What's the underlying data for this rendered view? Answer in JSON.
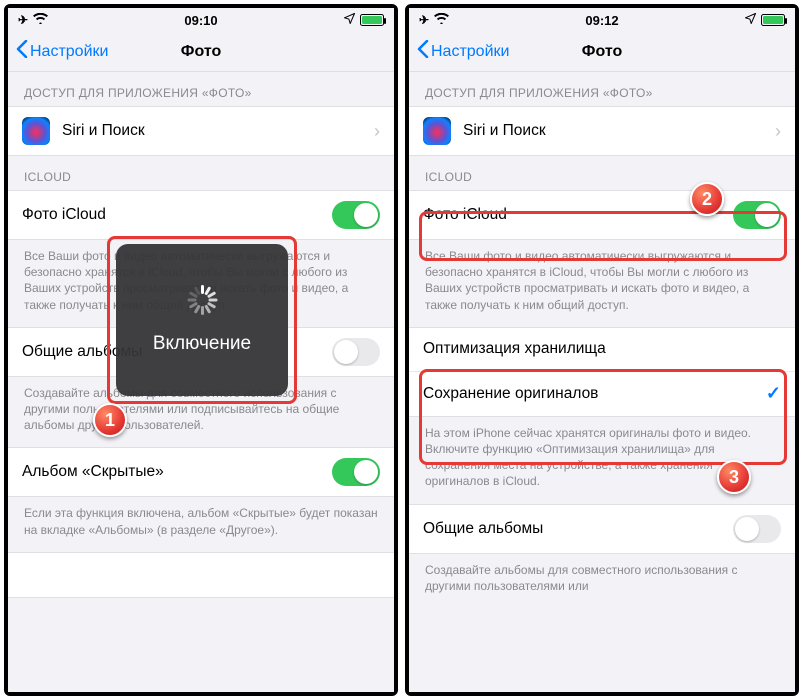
{
  "left": {
    "status_time": "09:10",
    "nav_back": "Настройки",
    "nav_title": "Фото",
    "section_app_access": "ДОСТУП ДЛЯ ПРИЛОЖЕНИЯ «ФОТО»",
    "siri_search": "Siri и Поиск",
    "section_icloud": "ICLOUD",
    "icloud_photo": "Фото iCloud",
    "icloud_footer": "Все Ваши фото и видео автоматически выгружаются и безопасно хранятся в iCloud, чтобы Вы могли с любого из Ваших устройств просматривать и искать фото и видео, а также получать к ним общий доступ.",
    "shared_albums": "Общие альбомы",
    "shared_footer": "Создавайте альбомы для совместного использования с другими пользователями или подписывайтесь на общие альбомы других пользователей.",
    "hidden_album": "Альбом «Скрытые»",
    "hidden_footer": "Если эта функция включена, альбом «Скрытые» будет показан на вкладке «Альбомы» (в разделе «Другое»).",
    "hud_text": "Включение",
    "badge1": "1"
  },
  "right": {
    "status_time": "09:12",
    "nav_back": "Настройки",
    "nav_title": "Фото",
    "section_app_access": "ДОСТУП ДЛЯ ПРИЛОЖЕНИЯ «ФОТО»",
    "siri_search": "Siri и Поиск",
    "section_icloud": "ICLOUD",
    "icloud_photo": "Фото iCloud",
    "icloud_footer": "Все Ваши фото и видео автоматически выгружаются и безопасно хранятся в iCloud, чтобы Вы могли с любого из Ваших устройств просматривать и искать фото и видео, а также получать к ним общий доступ.",
    "optimize": "Оптимизация хранилища",
    "keep_originals": "Сохранение оригиналов",
    "storage_footer": "На этом iPhone сейчас хранятся оригиналы фото и видео. Включите функцию «Оптимизация хранилища» для сохранения места на устройстве, а также хранения оригиналов в iCloud.",
    "shared_albums": "Общие альбомы",
    "shared_footer": "Создавайте альбомы для совместного использования с другими пользователями или",
    "badge2": "2",
    "badge3": "3"
  }
}
